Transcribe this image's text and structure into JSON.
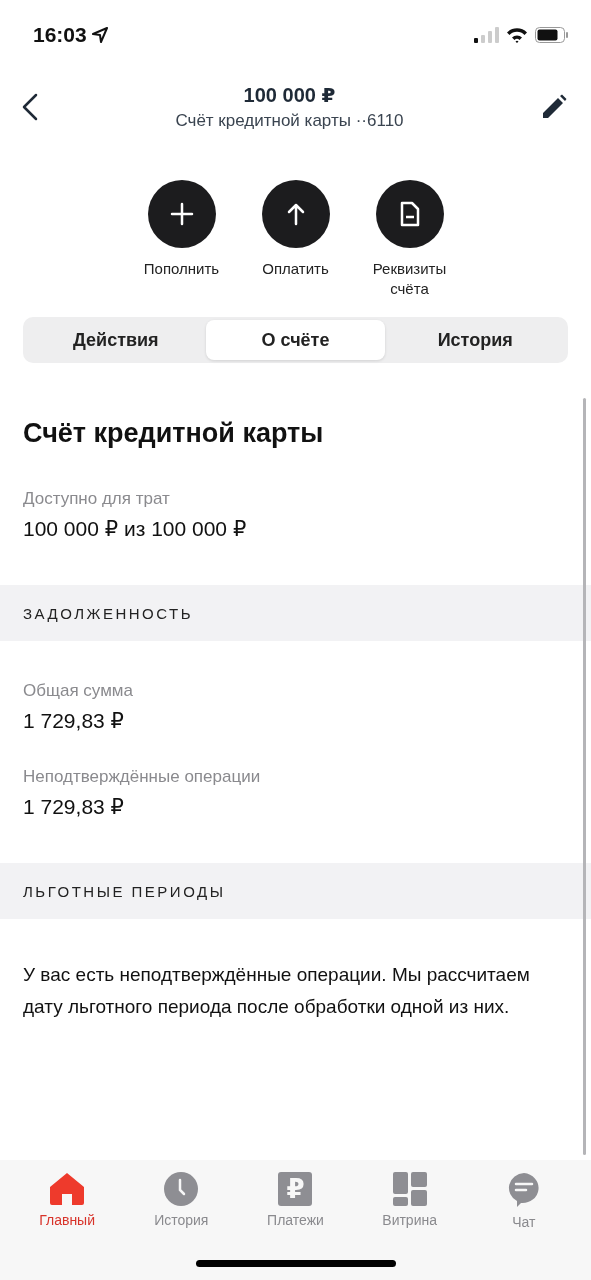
{
  "status_bar": {
    "time": "16:03"
  },
  "header": {
    "title": "100 000 ₽",
    "subtitle": "Счёт кредитной карты ··6110"
  },
  "actions": [
    {
      "kind": "plus",
      "label": "Пополнить"
    },
    {
      "kind": "arrow",
      "label": "Оплатить"
    },
    {
      "kind": "document",
      "label": "Реквизиты счёта"
    }
  ],
  "segments": [
    {
      "label": "Действия",
      "selected": false
    },
    {
      "label": "О счёте",
      "selected": true
    },
    {
      "label": "История",
      "selected": false
    }
  ],
  "content": [
    {
      "kind": "heading",
      "text": "Счёт кредитной карты"
    },
    {
      "kind": "field",
      "label": "Доступно для трат",
      "value": "100 000 ₽ из 100 000 ₽"
    },
    {
      "kind": "section",
      "text": "ЗАДОЛЖЕННОСТЬ"
    },
    {
      "kind": "field",
      "label": "Общая сумма",
      "value": "1 729,83 ₽"
    },
    {
      "kind": "field",
      "label": "Неподтверждённые операции",
      "value": "1 729,83 ₽"
    },
    {
      "kind": "section",
      "text": "ЛЬГОТНЫЕ ПЕРИОДЫ"
    },
    {
      "kind": "paragraph",
      "text": "У вас есть неподтверждённые операции. Мы рассчитаем дату льготного периода после обработки одной из них."
    }
  ],
  "tab_bar": [
    {
      "kind": "home",
      "label": "Главный",
      "selected": true
    },
    {
      "kind": "clock",
      "label": "История",
      "selected": false
    },
    {
      "kind": "ruble",
      "glyph": "₽",
      "label": "Платежи",
      "selected": false
    },
    {
      "kind": "tiles",
      "label": "Витрина",
      "selected": false
    },
    {
      "kind": "chat",
      "label": "Чат",
      "selected": false
    }
  ]
}
